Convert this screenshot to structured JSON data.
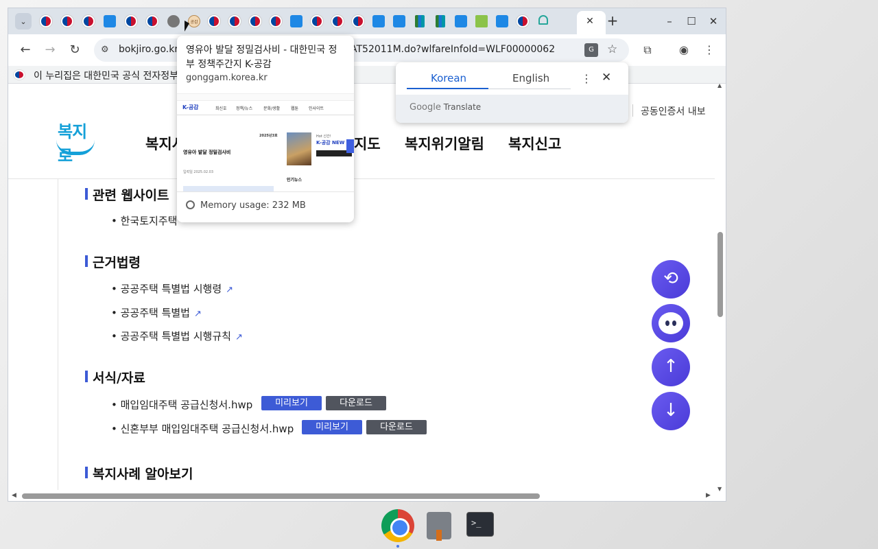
{
  "browser": {
    "tab_favicons": [
      "gov-emblem",
      "gov-emblem",
      "gov-emblem",
      "bokjiro-icon",
      "gov-emblem",
      "gov-emblem",
      "globe-icon",
      "gonggam-icon",
      "gov-emblem",
      "gov-emblem",
      "gov-emblem",
      "gov-emblem",
      "bokjiro-icon",
      "gov-emblem",
      "gov-emblem",
      "gov-emblem",
      "bokjiro-icon",
      "bokjiro-icon",
      "lh-icon",
      "lh-icon",
      "bokjiro-icon",
      "lh-leaf-icon",
      "bokjiro-icon",
      "gov-emblem",
      "home-icon"
    ],
    "url_visible_left": "bokjiro.go.kr",
    "url_visible_right": "AT52011M.do?wlfareInfoId=WLF00000062",
    "infobar_text": "이 누리집은 대한민국 공식 전자정부"
  },
  "hovercard": {
    "title": "영유아 발달 정밀검사비 - 대한민국 정부 정책주간지 K-공감",
    "domain": "gonggam.korea.kr",
    "memory": "Memory usage: 232 MB",
    "thumb_logo": "K-공감",
    "thumb_menu": [
      "최신호",
      "정책/뉴스",
      "문화/생활",
      "웹툰",
      "인사이트"
    ],
    "thumb_heading": "영유아 발달 정밀검사비",
    "thumb_date": "2025년3호",
    "thumb_card_top": "Hot 신간!",
    "thumb_card_brand": "K-공감",
    "thumb_card_new": "NEW",
    "thumb_sub": "인기뉴스",
    "thumb_meta": "입력일 2025.02.03"
  },
  "translate": {
    "lang_source": "Korean",
    "lang_target": "English",
    "brand_google": "Google",
    "brand_translate": "Translate"
  },
  "site": {
    "cert_link": "공동인증서 내보",
    "logo_text": "복지로",
    "nav": [
      "복지시",
      "지도",
      "복지위기알림",
      "복지신고"
    ]
  },
  "sections": {
    "related_sites": {
      "title": "관련 웹사이트",
      "items": [
        "• 한국토지주택"
      ]
    },
    "legal_basis": {
      "title": "근거법령",
      "items": [
        "• 공공주택 특별법 시행령",
        "• 공공주택 특별법",
        "• 공공주택 특별법 시행규칙"
      ]
    },
    "forms": {
      "title": "서식/자료",
      "items": [
        {
          "name": "• 매입임대주택 공급신청서.hwp",
          "preview": "미리보기",
          "download": "다운로드"
        },
        {
          "name": "• 신혼부부 매입임대주택 공급신청서.hwp",
          "preview": "미리보기",
          "download": "다운로드"
        }
      ]
    },
    "cases": {
      "title": "복지사례 알아보기"
    }
  },
  "colors": {
    "accent": "#3d5bd6",
    "download_btn": "#51555e",
    "float_btn": "#5a4be6"
  }
}
